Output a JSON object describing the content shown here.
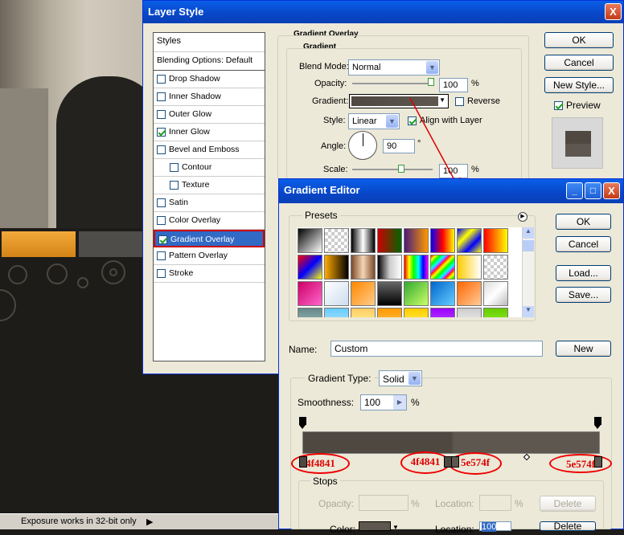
{
  "status": {
    "text": "Exposure works in 32-bit only"
  },
  "layer_style": {
    "title": "Layer Style",
    "close": "X",
    "styles_header": "Styles",
    "blending": "Blending Options: Default",
    "items": [
      {
        "label": "Drop Shadow",
        "checked": false
      },
      {
        "label": "Inner Shadow",
        "checked": false
      },
      {
        "label": "Outer Glow",
        "checked": false
      },
      {
        "label": "Inner Glow",
        "checked": true
      },
      {
        "label": "Bevel and Emboss",
        "checked": false
      },
      {
        "label": "Contour",
        "checked": false
      },
      {
        "label": "Texture",
        "checked": false
      },
      {
        "label": "Satin",
        "checked": false
      },
      {
        "label": "Color Overlay",
        "checked": false
      },
      {
        "label": "Gradient Overlay",
        "checked": true
      },
      {
        "label": "Pattern Overlay",
        "checked": false
      },
      {
        "label": "Stroke",
        "checked": false
      }
    ],
    "section": "Gradient Overlay",
    "subsection": "Gradient",
    "blend_mode_label": "Blend Mode:",
    "blend_mode": "Normal",
    "opacity_label": "Opacity:",
    "opacity": "100",
    "pct": "%",
    "gradient_label": "Gradient:",
    "reverse": "Reverse",
    "style_label": "Style:",
    "style": "Linear",
    "align": "Align with Layer",
    "angle_label": "Angle:",
    "angle": "90",
    "deg": "°",
    "scale_label": "Scale:",
    "scale": "100",
    "ok": "OK",
    "cancel": "Cancel",
    "new_style": "New Style...",
    "preview": "Preview"
  },
  "gradient_editor": {
    "title": "Gradient Editor",
    "presets": "Presets",
    "ok": "OK",
    "cancel": "Cancel",
    "load": "Load...",
    "save": "Save...",
    "name_label": "Name:",
    "name": "Custom",
    "new": "New",
    "type_label": "Gradient Type:",
    "type": "Solid",
    "smooth_label": "Smoothness:",
    "smooth": "100",
    "pct": "%",
    "stops": "Stops",
    "opacity_label": "Opacity:",
    "location_label": "Location:",
    "delete": "Delete",
    "color_label": "Color:",
    "location2": "100",
    "annotations": [
      "4f4841",
      "4f4841",
      "5e574f",
      "5e574f"
    ],
    "colors": {
      "start": "#4f4841",
      "end": "#5e574f"
    }
  }
}
